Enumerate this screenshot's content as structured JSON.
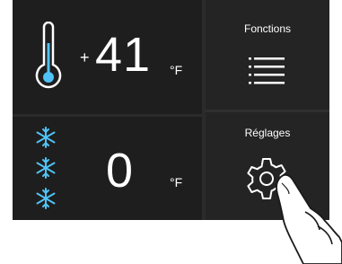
{
  "fridge": {
    "sign": "+",
    "temperature": "41",
    "unit": "°F",
    "icon": "thermometer-icon"
  },
  "freezer": {
    "temperature": "0",
    "unit": "°F",
    "icon": "snowflake-icon"
  },
  "menu": {
    "functions_label": "Fonctions",
    "functions_icon": "list-icon",
    "settings_label": "Réglages",
    "settings_icon": "gear-icon"
  },
  "colors": {
    "background": "#1e1e1e",
    "text": "#ffffff",
    "snowflake": "#4fc3f7"
  }
}
